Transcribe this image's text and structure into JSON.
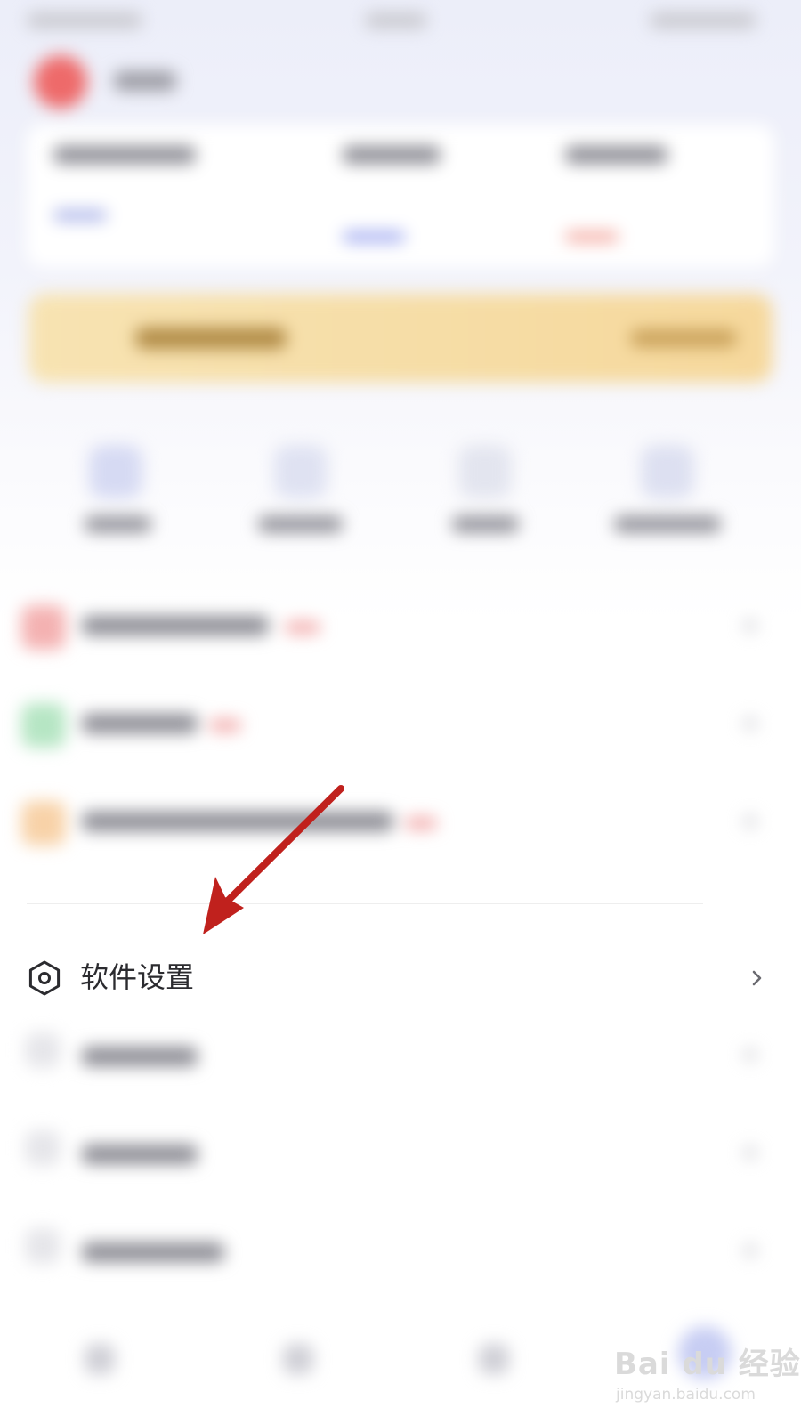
{
  "settings_item": {
    "label": "软件设置",
    "icon": "gear-hexagon-icon"
  },
  "annotation": {
    "arrow_color": "#c0211d"
  },
  "watermark": {
    "logo": "Bai du 经验",
    "url": "jingyan.baidu.com"
  },
  "colors": {
    "avatar": "#ee6a6a",
    "banner": "#f6d89c",
    "row_red": "#f4b2b2",
    "row_green": "#b6e6c4",
    "row_orange": "#f8d2a8"
  }
}
